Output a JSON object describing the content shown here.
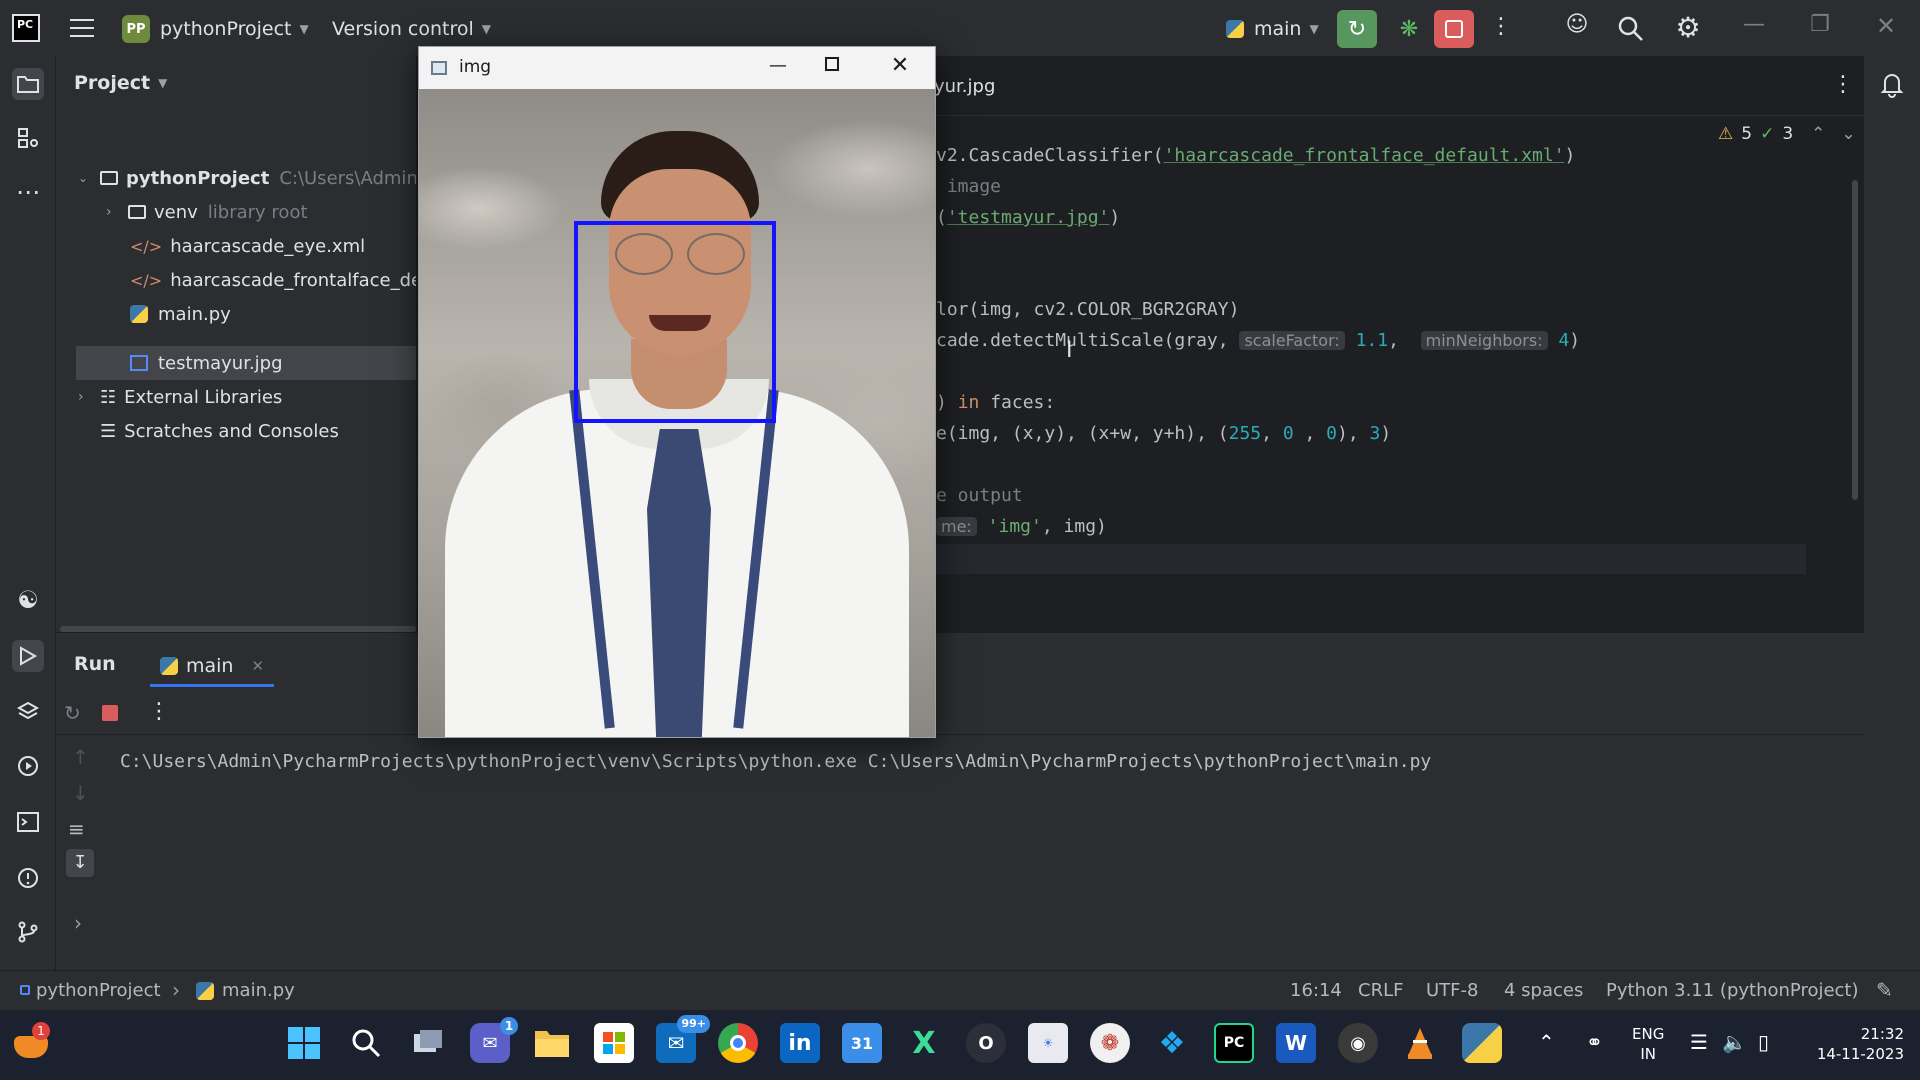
{
  "title_bar": {
    "project_badge": "PP",
    "project_name": "pythonProject",
    "version_control": "Version control",
    "run_config": "main"
  },
  "project_panel": {
    "header": "Project",
    "items": [
      {
        "label": "pythonProject",
        "hint": "C:\\Users\\Admin\\P"
      },
      {
        "label": "venv",
        "hint": "library root"
      },
      {
        "label": "haarcascade_eye.xml"
      },
      {
        "label": "haarcascade_frontalface_defa"
      },
      {
        "label": "main.py"
      },
      {
        "label": "testmayur.jpg"
      },
      {
        "label": "External Libraries"
      },
      {
        "label": "Scratches and Consoles"
      }
    ]
  },
  "editor": {
    "tab_label": "yur.jpg",
    "inspections": {
      "warnings": "5",
      "checks": "3"
    },
    "lines": [
      {
        "pre": "v2.CascadeClassifier(",
        "str": "'haarcascade_frontalface_default.xml'",
        "post": ")"
      },
      {
        "cmt": " image"
      },
      {
        "pre": "(",
        "str": "'testmayur.jpg'",
        "post": ")"
      },
      {
        "pre": "lor(img, cv2.COLOR_BGR2GRAY)"
      },
      {
        "pre": "cade.detectMultiScale(gray, ",
        "hint1": "scaleFactor:",
        "val1": "1.1",
        "hint2": "minNeighbors:",
        "val2": "4",
        "post": ")"
      },
      {
        "pre": ") ",
        "kw": "in",
        "post": " faces:"
      },
      {
        "pre": "e(img, (x,y), (x+w, y+h), (",
        "n1": "255",
        "n2": "0",
        "n3": "0",
        "n4": "3"
      },
      {
        "cmt": "e output"
      },
      {
        "hint": "me:",
        "str": "'img'",
        "post": ", img)"
      }
    ]
  },
  "run_panel": {
    "tab_run": "Run",
    "tab_main": "main",
    "console_line": "C:\\Users\\Admin\\PycharmProjects\\pythonProject\\venv\\Scripts\\python.exe C:\\Users\\Admin\\PycharmProjects\\pythonProject\\main.py"
  },
  "image_window": {
    "title": "img"
  },
  "status_bar": {
    "breadcrumb_project": "pythonProject",
    "breadcrumb_file": "main.py",
    "position": "16:14",
    "line_ending": "CRLF",
    "encoding": "UTF-8",
    "indent": "4 spaces",
    "interpreter": "Python 3.11 (pythonProject)"
  },
  "taskbar": {
    "badge_count": "1",
    "teams_badge": "1",
    "mail_badge": "99+",
    "calendar_day": "31",
    "lang_line1": "ENG",
    "lang_line2": "IN",
    "time": "21:32",
    "date": "14-11-2023"
  },
  "colors": {
    "accent_blue": "#3574f0",
    "face_box": "#1414ff",
    "run_green": "#57965c",
    "stop_red": "#db5c5c"
  }
}
